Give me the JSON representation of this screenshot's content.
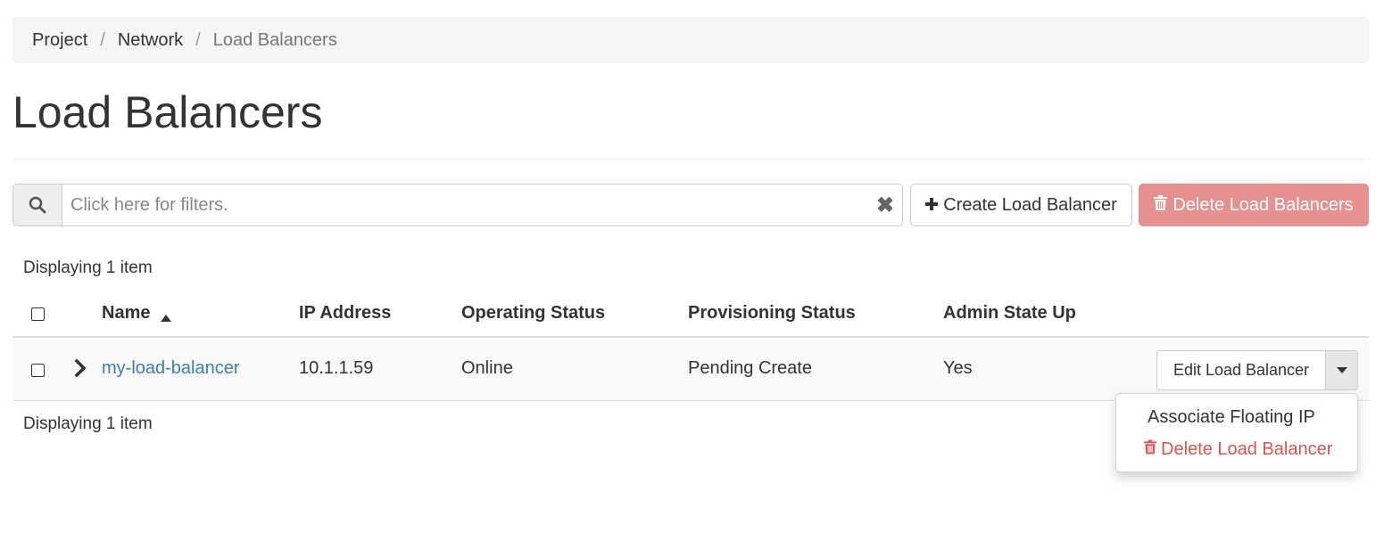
{
  "breadcrumb": {
    "items": [
      "Project",
      "Network",
      "Load Balancers"
    ],
    "separator": "/"
  },
  "page": {
    "title": "Load Balancers"
  },
  "filter": {
    "placeholder": "Click here for filters.",
    "clear_symbol": "✖"
  },
  "actions": {
    "create_label": "Create Load Balancer",
    "delete_label": "Delete Load Balancers"
  },
  "table": {
    "count_text": "Displaying 1 item",
    "columns": [
      "Name",
      "IP Address",
      "Operating Status",
      "Provisioning Status",
      "Admin State Up"
    ],
    "rows": [
      {
        "name": "my-load-balancer",
        "ip": "10.1.1.59",
        "operating_status": "Online",
        "provisioning_status": "Pending Create",
        "admin_state_up": "Yes"
      }
    ]
  },
  "row_actions": {
    "edit_label": "Edit Load Balancer",
    "menu": [
      "Associate Floating IP",
      "Delete Load Balancer"
    ]
  },
  "colors": {
    "link": "#3b7dbb",
    "danger": "#d9534f",
    "danger_button": "#e6918f",
    "header_bg": "#f5f5f5"
  },
  "icons": [
    "search-icon",
    "close-icon",
    "plus-icon",
    "trash-icon",
    "sort-ascending-icon",
    "chevron-right-icon",
    "caret-down-icon"
  ]
}
